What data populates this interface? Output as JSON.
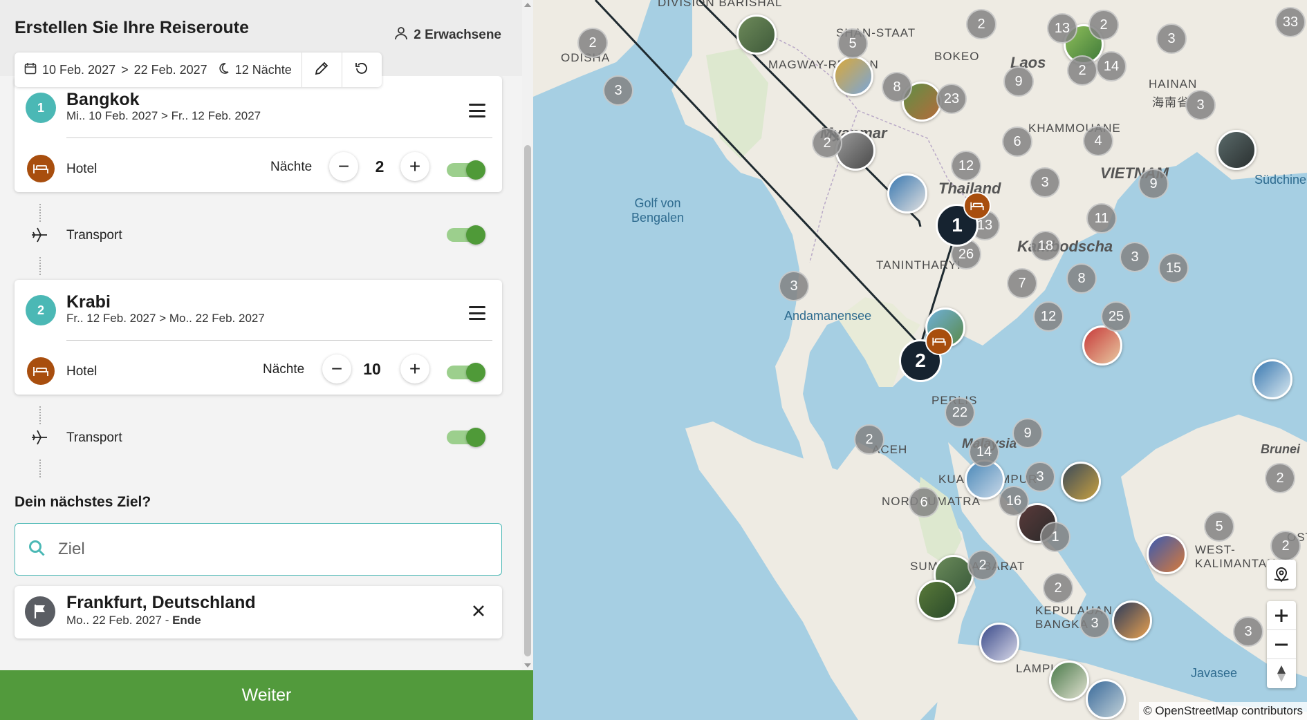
{
  "header": {
    "title": "Erstellen Sie Ihre Reiseroute",
    "travellers": "2 Erwachsene",
    "date_from": "10 Feb. 2027",
    "date_sep": ">",
    "date_to": "22 Feb. 2027",
    "nights": "12 Nächte"
  },
  "stops": [
    {
      "number": "1",
      "city": "Bangkok",
      "dates": "Mi.. 10 Feb. 2027 > Fr.. 12 Feb. 2027",
      "accommodation": "Hotel",
      "nights_label": "Nächte",
      "nights": "2",
      "transport": "Transport"
    },
    {
      "number": "2",
      "city": "Krabi",
      "dates": "Fr.. 12 Feb. 2027 > Mo.. 22 Feb. 2027",
      "accommodation": "Hotel",
      "nights_label": "Nächte",
      "nights": "10",
      "transport": "Transport"
    }
  ],
  "next": {
    "title": "Dein nächstes Ziel?",
    "search_placeholder": "Ziel"
  },
  "destination": {
    "city": "Frankfurt, Deutschland",
    "date": "Mo.. 22 Feb. 2027 - ",
    "end_label": "Ende"
  },
  "footer": {
    "continue_label": "Weiter"
  },
  "map": {
    "labels": {
      "division": "DIVISION BARISHAL",
      "odisha": "ODISHA",
      "shan": "SHAN-STAAT",
      "magway": "MAGWAY-REGION",
      "bokeo": "BOKEO",
      "laos": "Laos",
      "hainan": "HAINAN",
      "hainan_cn": "海南省",
      "khammouane": "KHAMMOUANE",
      "myanmar": "Myanmar",
      "vietnam": "VIETNAM",
      "thailand": "Thailand",
      "golf": "Golf von Bengalen",
      "suedchin": "Südchine",
      "kambodscha": "Kambodscha",
      "tanintharyi": "TANINTHARYI",
      "andamanensee": "Andamanensee",
      "perlis": "PERLIS",
      "malaysia": "Malaysia",
      "aceh": "ACEH",
      "kuala": "KUALA LUMPUR",
      "nordsumatra": "NORDSUMATRA",
      "brunei": "Brunei",
      "westkal": "WEST-KALIMANTAN",
      "sumbar": "SUMATERA BARAT",
      "kepulauan": "KEPULAUAN BANGKA",
      "lampung": "LAMPUNG",
      "javasee": "Javasee",
      "ost": "OST-"
    },
    "clusters": [
      "2",
      "5",
      "2",
      "13",
      "2",
      "33",
      "3",
      "8",
      "23",
      "9",
      "2",
      "14",
      "3",
      "3",
      "6",
      "4",
      "2",
      "12",
      "9",
      "13",
      "26",
      "3",
      "11",
      "18",
      "3",
      "15",
      "3",
      "7",
      "8",
      "12",
      "25",
      "22",
      "2",
      "9",
      "14",
      "3",
      "16",
      "6",
      "1",
      "2",
      "5",
      "2",
      "2",
      "3",
      "3",
      "2"
    ],
    "stop_markers": [
      "1",
      "2"
    ],
    "attribution": "© OpenStreetMap contributors"
  }
}
